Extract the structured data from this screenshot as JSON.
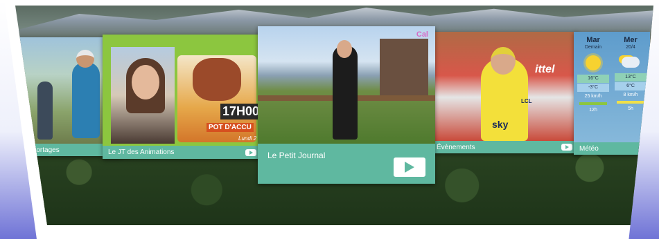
{
  "tiles": {
    "reportages": {
      "label": "Reportages"
    },
    "jt_animations": {
      "label": "Le JT des Animations",
      "poster_time": "17H00",
      "poster_banner": "POT D'ACCU",
      "poster_date": "Lundi 2"
    },
    "petit_journal": {
      "label": "Le Petit Journal",
      "logo": "Cal"
    },
    "evenements": {
      "label": "Évènements",
      "jersey_text": "sky",
      "jersey_brand": "LCL",
      "banner_text": "ittel"
    },
    "meteo": {
      "label": "Météo",
      "days": [
        {
          "day": "Mar",
          "sub": "Demain",
          "high": "16°C",
          "low": "-3°C",
          "wind": "25 km/h",
          "extra": "12h",
          "icon": "sun-icon"
        },
        {
          "day": "Mer",
          "sub": "20/4",
          "high": "13°C",
          "low": "6°C",
          "wind": "8 km/h",
          "extra": "5h",
          "icon": "cloud-sun-icon"
        }
      ]
    }
  },
  "colors": {
    "caption": "#5fb8a0",
    "jt_background": "#8cc63f"
  }
}
